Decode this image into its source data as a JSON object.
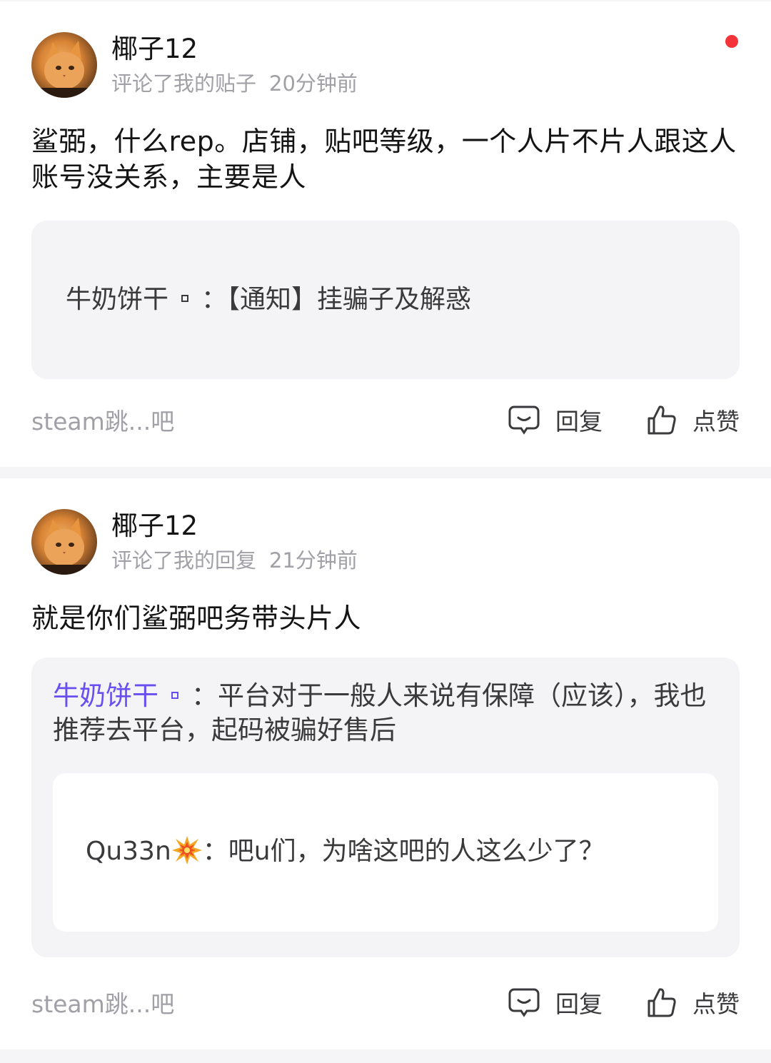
{
  "notifications": [
    {
      "username": "椰子12",
      "action": "评论了我的贴子",
      "time": "20分钟前",
      "unread": true,
      "content": "鲨弼，什么rep。店铺，贴吧等级，一个人片不片人跟这人账号没关系，主要是人",
      "quote": {
        "author": "牛奶饼干",
        "separator": "：",
        "text": "【通知】挂骗子及解惑"
      },
      "forum": "steam跳...吧",
      "reply_label": "回复",
      "like_label": "点赞"
    },
    {
      "username": "椰子12",
      "action": "评论了我的回复",
      "time": "21分钟前",
      "unread": false,
      "content": "就是你们鲨弼吧务带头片人",
      "quote": {
        "author": "牛奶饼干",
        "separator": "：",
        "text": "平台对于一般人来说有保障（应该），我也推荐去平台，起码被骗好售后",
        "nested": {
          "author": "Qu33n",
          "separator": "：",
          "text": "吧u们，为啥这吧的人这么少了？"
        }
      },
      "forum": "steam跳...吧",
      "reply_label": "回复",
      "like_label": "点赞"
    }
  ],
  "colors": {
    "accent": "#6a4ff0",
    "unread_dot": "#f5343a",
    "muted_text": "#a0a0a6",
    "quote_bg": "#f4f4f7"
  },
  "icons": {
    "reply": "comment-bubble-icon",
    "like": "thumbs-up-icon",
    "unread": "red-dot-icon",
    "emoji": "collision-emoji-icon"
  }
}
